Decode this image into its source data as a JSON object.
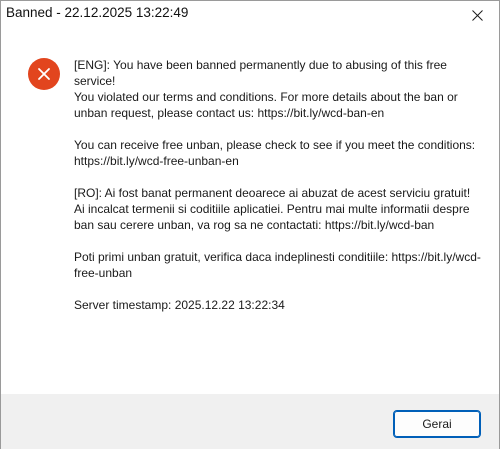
{
  "window": {
    "title": "Banned - 22.12.2025 13:22:49"
  },
  "icons": {
    "close": "close-icon",
    "error": "error-icon"
  },
  "colors": {
    "error_icon": "#e2451e",
    "button_border": "#005fb8",
    "footer_bg": "#f0f0f0"
  },
  "message": {
    "eng_line1": "[ENG]: You have been banned permanently due to abusing of this free service!",
    "eng_line2": "You violated our terms and conditions. For more details about the ban or unban request, please contact us: https://bit.ly/wcd-ban-en",
    "eng_unban": "You can receive free unban, please check to see if you meet the conditions: https://bit.ly/wcd-free-unban-en",
    "ro_line1": "[RO]: Ai fost banat permanent deoarece ai abuzat de acest serviciu gratuit!",
    "ro_line2": "Ai incalcat termenii si coditiile aplicatiei. Pentru mai multe informatii despre ban sau cerere unban, va rog sa ne contactati: https://bit.ly/wcd-ban",
    "ro_unban": "Poti primi unban gratuit, verifica daca indeplinesti conditiile: https://bit.ly/wcd-free-unban",
    "server_timestamp": "Server timestamp: 2025.12.22 13:22:34"
  },
  "buttons": {
    "ok_label": "Gerai"
  }
}
